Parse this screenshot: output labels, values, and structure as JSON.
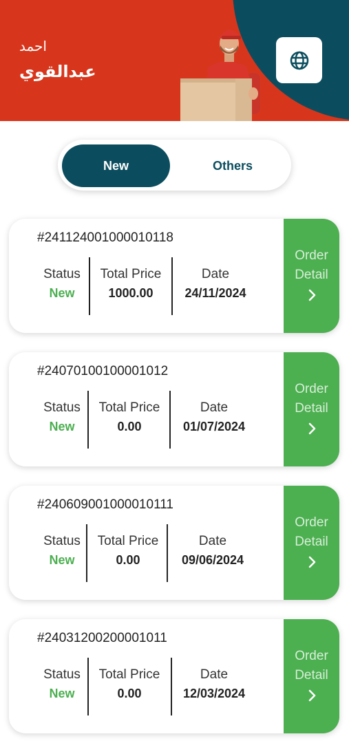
{
  "header": {
    "user_first_name": "احمد",
    "user_last_name": "عبدالقوي",
    "language_icon": "globe-icon",
    "colors": {
      "primary_red": "#d7361c",
      "teal": "#0b4d5e"
    }
  },
  "tabs": [
    {
      "label": "New",
      "active": true
    },
    {
      "label": "Others",
      "active": false
    }
  ],
  "labels": {
    "status": "Status",
    "total_price": "Total Price",
    "date": "Date",
    "order_detail_line1": "Order",
    "order_detail_line2": "Detail"
  },
  "orders": [
    {
      "id": "#24112400100001011​8",
      "status": "New",
      "total_price": "1000.00",
      "date": "24/11/2024"
    },
    {
      "id": "#24070100100001012",
      "status": "New",
      "total_price": "0.00",
      "date": "01/07/2024"
    },
    {
      "id": "#24060900100001011​1",
      "status": "New",
      "total_price": "0.00",
      "date": "09/06/2024"
    },
    {
      "id": "#24031200200001011",
      "status": "New",
      "total_price": "0.00",
      "date": "12/03/2024"
    }
  ],
  "status_color": "#4caf50",
  "detail_button_color": "#4caf50"
}
